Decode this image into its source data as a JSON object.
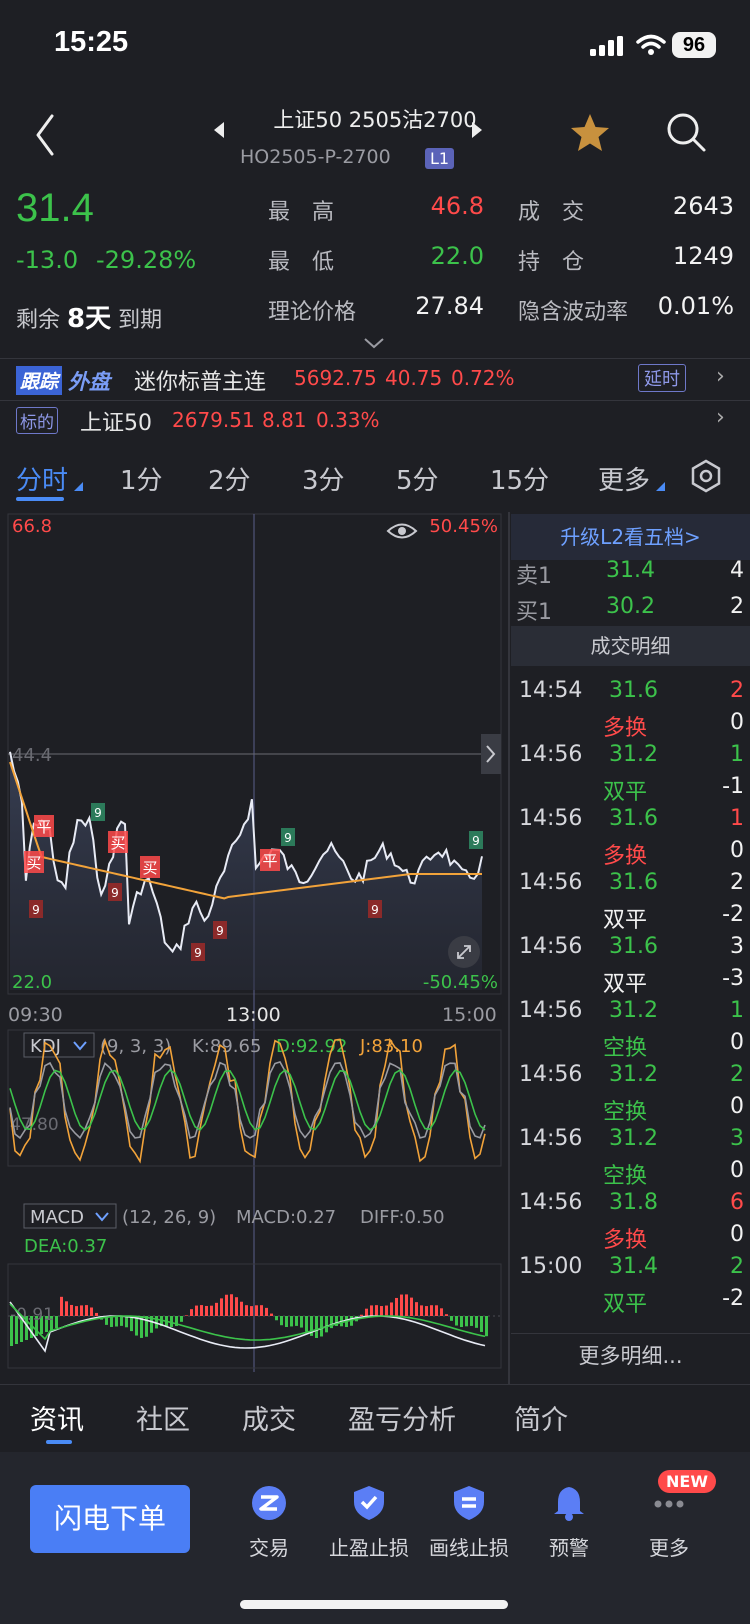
{
  "status": {
    "time": "15:25",
    "battery": "96"
  },
  "header": {
    "title": "上证50 2505沽2700",
    "code": "HO2505-P-2700",
    "level": "L1"
  },
  "quote": {
    "price": "31.4",
    "change": "-13.0",
    "change_pct": "-29.28%",
    "high_label": "最　高",
    "high": "46.8",
    "low_label": "最　低",
    "low": "22.0",
    "volume_label": "成　交",
    "volume": "2643",
    "oi_label": "持　仓",
    "oi": "1249",
    "theo_label": "理论价格",
    "theo": "27.84",
    "iv_label": "隐含波动率",
    "iv": "0.01%",
    "expire_prefix": "剩余",
    "expire_days": "8天",
    "expire_suffix": "到期"
  },
  "follow": {
    "badge": "跟踪",
    "badge2": "外盘",
    "name": "迷你标普主连",
    "price": "5692.75",
    "chg": "40.75",
    "pct": "0.72%",
    "delay": "延时"
  },
  "underlying": {
    "badge": "标的",
    "name": "上证50",
    "price": "2679.51",
    "chg": "8.81",
    "pct": "0.33%"
  },
  "periods": [
    "分时",
    "1分",
    "2分",
    "3分",
    "5分",
    "15分",
    "更多"
  ],
  "chart": {
    "y_max": "66.8",
    "y_mid": "44.4",
    "y_min": "22.0",
    "pct_max": "50.45%",
    "pct_min": "-50.45%",
    "times": [
      "09:30",
      "13:00",
      "15:00"
    ],
    "kdj": {
      "name": "KDJ",
      "params": "(9, 3, 3)",
      "k": "K:89.65",
      "d": "D:92.92",
      "j": "J:83.10",
      "mid": "47.80"
    },
    "macd": {
      "name": "MACD",
      "params": "(12, 26, 9)",
      "macd": "MACD:0.27",
      "diff": "DIFF:0.50",
      "dea": "DEA:0.37",
      "low": "-0.91"
    },
    "markers": [
      "平",
      "买",
      "买",
      "买",
      "平",
      "9"
    ]
  },
  "book": {
    "upgrade": "升级L2看五档>",
    "ask_label": "卖1",
    "ask": "31.4",
    "ask_vol": "4",
    "bid_label": "买1",
    "bid": "30.2",
    "bid_vol": "2",
    "detail_title": "成交明细",
    "more": "更多明细...",
    "trades": [
      {
        "time": "14:54",
        "price": "31.6",
        "vol": "2",
        "type": "多换",
        "oi": "0",
        "pc": "green",
        "vc": "red",
        "tc": "red"
      },
      {
        "time": "14:56",
        "price": "31.2",
        "vol": "1",
        "type": "双平",
        "oi": "-1",
        "pc": "green",
        "vc": "green",
        "tc": "green"
      },
      {
        "time": "14:56",
        "price": "31.6",
        "vol": "1",
        "type": "多换",
        "oi": "0",
        "pc": "green",
        "vc": "red",
        "tc": "red"
      },
      {
        "time": "14:56",
        "price": "31.6",
        "vol": "2",
        "type": "双平",
        "oi": "-2",
        "pc": "green",
        "vc": "white",
        "tc": "white"
      },
      {
        "time": "14:56",
        "price": "31.6",
        "vol": "3",
        "type": "双平",
        "oi": "-3",
        "pc": "green",
        "vc": "white",
        "tc": "white"
      },
      {
        "time": "14:56",
        "price": "31.2",
        "vol": "1",
        "type": "空换",
        "oi": "0",
        "pc": "green",
        "vc": "green",
        "tc": "green"
      },
      {
        "time": "14:56",
        "price": "31.2",
        "vol": "2",
        "type": "空换",
        "oi": "0",
        "pc": "green",
        "vc": "green",
        "tc": "green"
      },
      {
        "time": "14:56",
        "price": "31.2",
        "vol": "3",
        "type": "空换",
        "oi": "0",
        "pc": "green",
        "vc": "green",
        "tc": "green"
      },
      {
        "time": "14:56",
        "price": "31.8",
        "vol": "6",
        "type": "多换",
        "oi": "0",
        "pc": "green",
        "vc": "red",
        "tc": "red"
      },
      {
        "time": "15:00",
        "price": "31.4",
        "vol": "2",
        "type": "双平",
        "oi": "-2",
        "pc": "green",
        "vc": "green",
        "tc": "green"
      }
    ]
  },
  "bottom_tabs": [
    "资讯",
    "社区",
    "成交",
    "盈亏分析",
    "简介"
  ],
  "toolbar": {
    "flash": "闪电下单",
    "items": [
      {
        "label": "交易",
        "icon": "trade-icon"
      },
      {
        "label": "止盈止损",
        "icon": "shield-check-icon"
      },
      {
        "label": "画线止损",
        "icon": "draw-line-icon"
      },
      {
        "label": "预警",
        "icon": "bell-icon"
      },
      {
        "label": "更多",
        "icon": "more-dots-icon"
      }
    ],
    "new_badge": "NEW"
  },
  "colors": {
    "up": "#ff4a4a",
    "down": "#3cc24b",
    "accent": "#4a8bf5",
    "bg": "#1e1f24"
  }
}
